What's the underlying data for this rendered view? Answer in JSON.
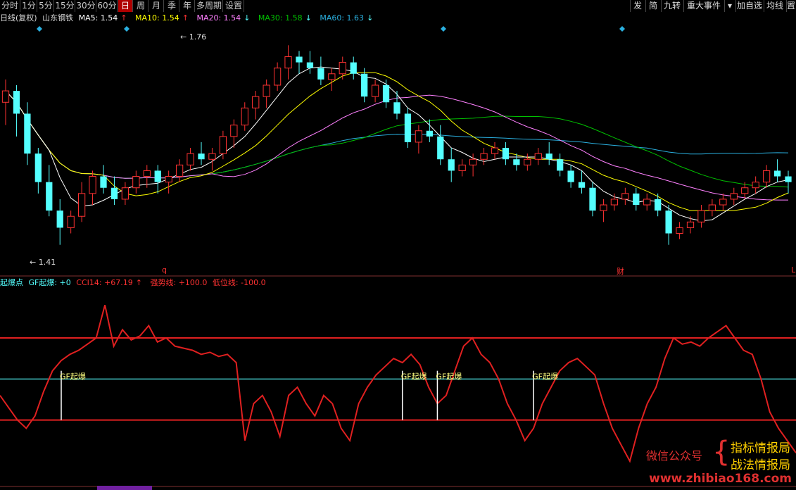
{
  "toolbar": {
    "period_tabs": [
      "分时",
      "1分",
      "5分",
      "15分",
      "30分",
      "60分",
      "日",
      "周",
      "月",
      "季",
      "年",
      "多周期",
      "设置"
    ],
    "active_tab": "日",
    "right_buttons": [
      "发",
      "简",
      "九转",
      "重大事件",
      "▾",
      "加自选",
      "均线",
      "置"
    ]
  },
  "info": {
    "chart_type": "日线(复权)",
    "stock_name": "山东钢铁",
    "ma5": "MA5: 1.54",
    "ma5_arrow": "↑",
    "ma10": "MA10: 1.54",
    "ma10_arrow": "↑",
    "ma20": "MA20: 1.54",
    "ma20_arrow": "↓",
    "ma30": "MA30: 1.58",
    "ma30_arrow": "↓",
    "ma60": "MA60: 1.63",
    "ma60_arrow": "↓"
  },
  "indicator": {
    "label1": "起爆点",
    "label2": "GF起爆: +0",
    "label3": "CCI14: +67.19",
    "label3_arrow": "↑",
    "label4": "强势线: +100.0",
    "label5": "低位线: -100.0",
    "signal_label": "GF起爆"
  },
  "annotations": {
    "high": "1.76",
    "low": "1.41",
    "marker_q": "q",
    "marker_cai": "财",
    "marker_l": "L"
  },
  "watermark": {
    "left": "微信公众号",
    "line1": "指标情报局",
    "line2": "战法情报局",
    "url": "www.zhibiao168.com"
  },
  "colors": {
    "up": "#ff3232",
    "down": "#54ffff",
    "ma5": "#ffffff",
    "ma10": "#ffff00",
    "ma20": "#ff80ff",
    "ma30": "#00c000",
    "ma60": "#2ab0e0",
    "cci": "#e02020"
  },
  "chart_data": {
    "type": "candlestick",
    "price_range": [
      1.38,
      1.79
    ],
    "candles": [
      [
        1.66,
        1.7,
        1.62,
        1.68
      ],
      [
        1.68,
        1.69,
        1.6,
        1.64
      ],
      [
        1.64,
        1.66,
        1.55,
        1.57
      ],
      [
        1.57,
        1.58,
        1.5,
        1.52
      ],
      [
        1.52,
        1.55,
        1.46,
        1.47
      ],
      [
        1.47,
        1.49,
        1.41,
        1.44
      ],
      [
        1.44,
        1.47,
        1.43,
        1.46
      ],
      [
        1.46,
        1.52,
        1.45,
        1.5
      ],
      [
        1.5,
        1.54,
        1.48,
        1.53
      ],
      [
        1.53,
        1.55,
        1.5,
        1.51
      ],
      [
        1.51,
        1.53,
        1.48,
        1.49
      ],
      [
        1.49,
        1.52,
        1.48,
        1.51
      ],
      [
        1.51,
        1.54,
        1.5,
        1.53
      ],
      [
        1.53,
        1.55,
        1.51,
        1.54
      ],
      [
        1.54,
        1.55,
        1.5,
        1.52
      ],
      [
        1.52,
        1.54,
        1.5,
        1.53
      ],
      [
        1.53,
        1.56,
        1.52,
        1.55
      ],
      [
        1.55,
        1.58,
        1.54,
        1.57
      ],
      [
        1.57,
        1.59,
        1.55,
        1.56
      ],
      [
        1.56,
        1.58,
        1.54,
        1.57
      ],
      [
        1.57,
        1.61,
        1.56,
        1.6
      ],
      [
        1.6,
        1.63,
        1.58,
        1.62
      ],
      [
        1.62,
        1.66,
        1.61,
        1.65
      ],
      [
        1.65,
        1.68,
        1.63,
        1.67
      ],
      [
        1.67,
        1.7,
        1.65,
        1.69
      ],
      [
        1.69,
        1.73,
        1.68,
        1.72
      ],
      [
        1.72,
        1.76,
        1.7,
        1.74
      ],
      [
        1.74,
        1.75,
        1.71,
        1.73
      ],
      [
        1.73,
        1.75,
        1.71,
        1.72
      ],
      [
        1.72,
        1.74,
        1.69,
        1.7
      ],
      [
        1.7,
        1.72,
        1.68,
        1.71
      ],
      [
        1.71,
        1.74,
        1.7,
        1.73
      ],
      [
        1.73,
        1.74,
        1.7,
        1.71
      ],
      [
        1.71,
        1.72,
        1.66,
        1.67
      ],
      [
        1.67,
        1.7,
        1.66,
        1.69
      ],
      [
        1.69,
        1.7,
        1.65,
        1.66
      ],
      [
        1.66,
        1.68,
        1.63,
        1.64
      ],
      [
        1.64,
        1.65,
        1.58,
        1.59
      ],
      [
        1.59,
        1.62,
        1.57,
        1.61
      ],
      [
        1.61,
        1.63,
        1.59,
        1.6
      ],
      [
        1.6,
        1.62,
        1.55,
        1.56
      ],
      [
        1.56,
        1.58,
        1.52,
        1.54
      ],
      [
        1.54,
        1.56,
        1.53,
        1.55
      ],
      [
        1.55,
        1.57,
        1.53,
        1.56
      ],
      [
        1.56,
        1.58,
        1.55,
        1.57
      ],
      [
        1.57,
        1.59,
        1.56,
        1.58
      ],
      [
        1.58,
        1.59,
        1.55,
        1.56
      ],
      [
        1.56,
        1.57,
        1.54,
        1.55
      ],
      [
        1.55,
        1.57,
        1.54,
        1.56
      ],
      [
        1.56,
        1.58,
        1.55,
        1.57
      ],
      [
        1.57,
        1.59,
        1.55,
        1.56
      ],
      [
        1.56,
        1.57,
        1.53,
        1.54
      ],
      [
        1.54,
        1.55,
        1.51,
        1.52
      ],
      [
        1.52,
        1.54,
        1.5,
        1.51
      ],
      [
        1.51,
        1.52,
        1.46,
        1.47
      ],
      [
        1.47,
        1.49,
        1.45,
        1.48
      ],
      [
        1.48,
        1.5,
        1.47,
        1.49
      ],
      [
        1.49,
        1.51,
        1.48,
        1.5
      ],
      [
        1.5,
        1.51,
        1.47,
        1.48
      ],
      [
        1.48,
        1.5,
        1.47,
        1.49
      ],
      [
        1.49,
        1.5,
        1.46,
        1.47
      ],
      [
        1.47,
        1.48,
        1.41,
        1.43
      ],
      [
        1.43,
        1.45,
        1.42,
        1.44
      ],
      [
        1.44,
        1.46,
        1.43,
        1.45
      ],
      [
        1.45,
        1.48,
        1.44,
        1.47
      ],
      [
        1.47,
        1.49,
        1.46,
        1.48
      ],
      [
        1.48,
        1.5,
        1.47,
        1.49
      ],
      [
        1.49,
        1.51,
        1.48,
        1.5
      ],
      [
        1.5,
        1.52,
        1.49,
        1.51
      ],
      [
        1.51,
        1.53,
        1.5,
        1.52
      ],
      [
        1.52,
        1.55,
        1.51,
        1.54
      ],
      [
        1.54,
        1.56,
        1.52,
        1.53
      ],
      [
        1.53,
        1.54,
        1.5,
        1.52
      ]
    ],
    "cci": [
      -40,
      -70,
      -100,
      -120,
      -90,
      -30,
      20,
      45,
      60,
      70,
      85,
      100,
      180,
      80,
      120,
      95,
      105,
      130,
      90,
      100,
      80,
      75,
      70,
      60,
      65,
      55,
      60,
      40,
      -150,
      -60,
      -40,
      -80,
      -140,
      -40,
      -20,
      -60,
      -90,
      -40,
      -60,
      -120,
      -150,
      -60,
      -20,
      10,
      30,
      50,
      40,
      60,
      35,
      -20,
      -60,
      -40,
      20,
      80,
      100,
      60,
      40,
      0,
      -60,
      -100,
      -150,
      -120,
      -60,
      -20,
      20,
      40,
      50,
      30,
      10,
      -60,
      -120,
      -160,
      -200,
      -120,
      -60,
      -20,
      50,
      100,
      85,
      90,
      80,
      100,
      115,
      130,
      100,
      70,
      60,
      0,
      -80,
      -120,
      -150,
      -180
    ],
    "cci_range": [
      -260,
      220
    ],
    "strong_line": 100,
    "low_line": -100,
    "signals": [
      7,
      46,
      50,
      61
    ]
  }
}
